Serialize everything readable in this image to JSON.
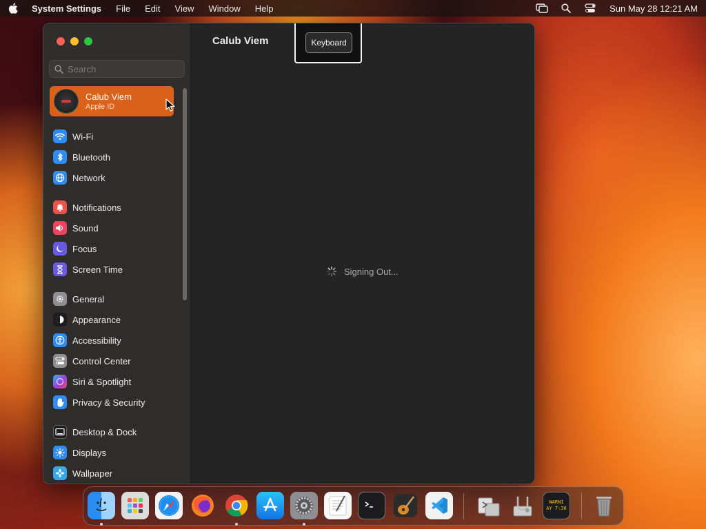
{
  "menubar": {
    "app_name": "System Settings",
    "menus": [
      "File",
      "Edit",
      "View",
      "Window",
      "Help"
    ],
    "clock": "Sun May 28  12:21 AM"
  },
  "sidebar": {
    "search_placeholder": "Search",
    "account": {
      "name": "Calub Viem",
      "subtitle": "Apple ID"
    },
    "items": [
      {
        "label": "Wi-Fi",
        "icon": "wifi-icon",
        "color": "#2f8cf5"
      },
      {
        "label": "Bluetooth",
        "icon": "bluetooth-icon",
        "color": "#2f8cf5"
      },
      {
        "label": "Network",
        "icon": "globe-icon",
        "color": "#2f8cf5"
      },
      {
        "label": "Notifications",
        "icon": "bell-icon",
        "color": "#f0524a"
      },
      {
        "label": "Sound",
        "icon": "speaker-icon",
        "color": "#f0435e"
      },
      {
        "label": "Focus",
        "icon": "moon-icon",
        "color": "#6a5ae0"
      },
      {
        "label": "Screen Time",
        "icon": "hourglass-icon",
        "color": "#6a5ae0"
      },
      {
        "label": "General",
        "icon": "gear-icon",
        "color": "#8e8e93"
      },
      {
        "label": "Appearance",
        "icon": "appearance-icon",
        "color": "#1c1c1e"
      },
      {
        "label": "Accessibility",
        "icon": "accessibility-icon",
        "color": "#2f8cf5"
      },
      {
        "label": "Control Center",
        "icon": "control-center-icon",
        "color": "#8e8e93"
      },
      {
        "label": "Siri & Spotlight",
        "icon": "siri-icon",
        "color": "#9b3fe0"
      },
      {
        "label": "Privacy & Security",
        "icon": "hand-icon",
        "color": "#2f8cf5"
      },
      {
        "label": "Desktop & Dock",
        "icon": "desktop-icon",
        "color": "#1c1c1e"
      },
      {
        "label": "Displays",
        "icon": "sun-icon",
        "color": "#2f8cf5"
      },
      {
        "label": "Wallpaper",
        "icon": "wallpaper-icon",
        "color": "#38a8e8"
      }
    ]
  },
  "main": {
    "title": "Calub Viem",
    "tooltip_button": "Keyboard",
    "status": "Signing Out..."
  },
  "dock": {
    "apps": [
      {
        "name": "Finder",
        "icon": "finder-icon",
        "running": true
      },
      {
        "name": "Launchpad",
        "icon": "launchpad-icon",
        "running": false
      },
      {
        "name": "Safari",
        "icon": "safari-icon",
        "running": false
      },
      {
        "name": "Firefox",
        "icon": "firefox-icon",
        "running": false
      },
      {
        "name": "Chrome",
        "icon": "chrome-icon",
        "running": true
      },
      {
        "name": "App Store",
        "icon": "app-store-icon",
        "running": false
      },
      {
        "name": "System Settings",
        "icon": "system-settings-icon",
        "running": true
      },
      {
        "name": "TextEdit",
        "icon": "textedit-icon",
        "running": false
      },
      {
        "name": "Terminal",
        "icon": "terminal-icon",
        "running": false
      },
      {
        "name": "GarageBand",
        "icon": "garageband-icon",
        "running": false
      },
      {
        "name": "Visual Studio Code",
        "icon": "vscode-icon",
        "running": false
      },
      {
        "name": "Migration Assistant",
        "icon": "migration-icon",
        "running": false
      },
      {
        "name": "Disk Utility",
        "icon": "disk-utility-icon",
        "running": false
      },
      {
        "name": "Console",
        "icon": "console-icon",
        "running": false,
        "text": "WARNI\nAY 7:36"
      },
      {
        "name": "Trash",
        "icon": "trash-icon",
        "running": false
      }
    ]
  }
}
